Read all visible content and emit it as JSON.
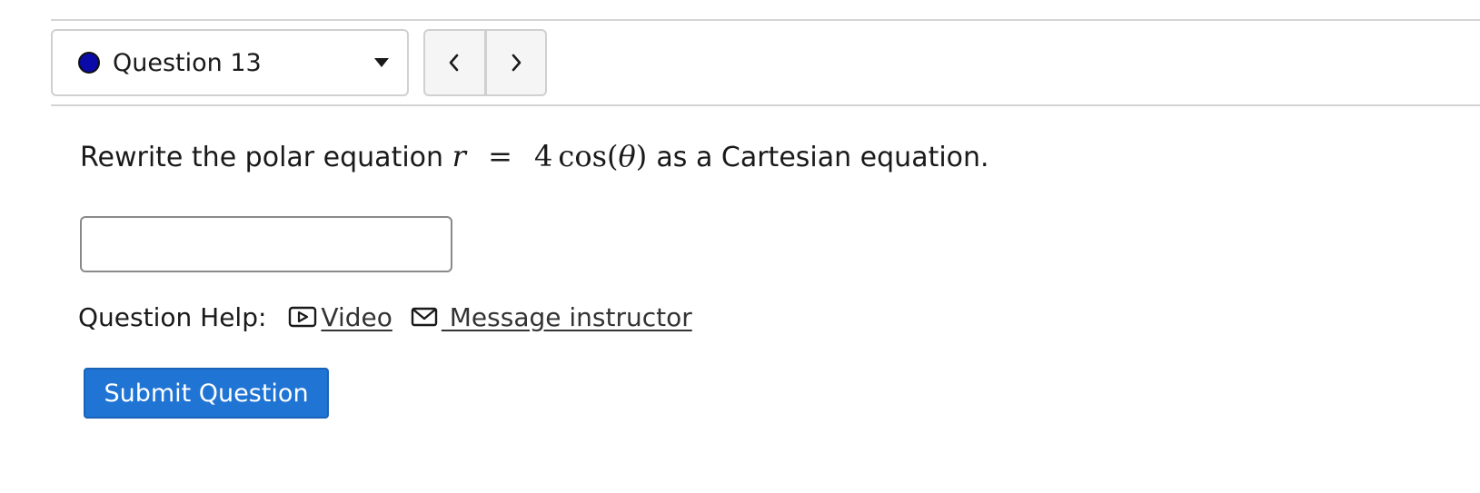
{
  "question_nav": {
    "selected_label": "Question 13",
    "status_color": "#0a0aa8",
    "prev_icon": "chevron-left-icon",
    "next_icon": "chevron-right-icon"
  },
  "question": {
    "text_before": "Rewrite the polar equation",
    "math": {
      "lhs": "r",
      "equals": "=",
      "rhs_coefficient": "4",
      "rhs_function": "cos",
      "rhs_open": "(",
      "rhs_arg": "θ",
      "rhs_close": ")"
    },
    "text_after": "as a Cartesian equation."
  },
  "answer": {
    "value": "",
    "placeholder": ""
  },
  "help": {
    "label": "Question Help:",
    "video_label": "Video",
    "video_icon": "video-icon",
    "message_label": " Message instructor",
    "message_icon": "envelope-icon"
  },
  "submit": {
    "label": "Submit Question",
    "color": "#1f74d4"
  }
}
